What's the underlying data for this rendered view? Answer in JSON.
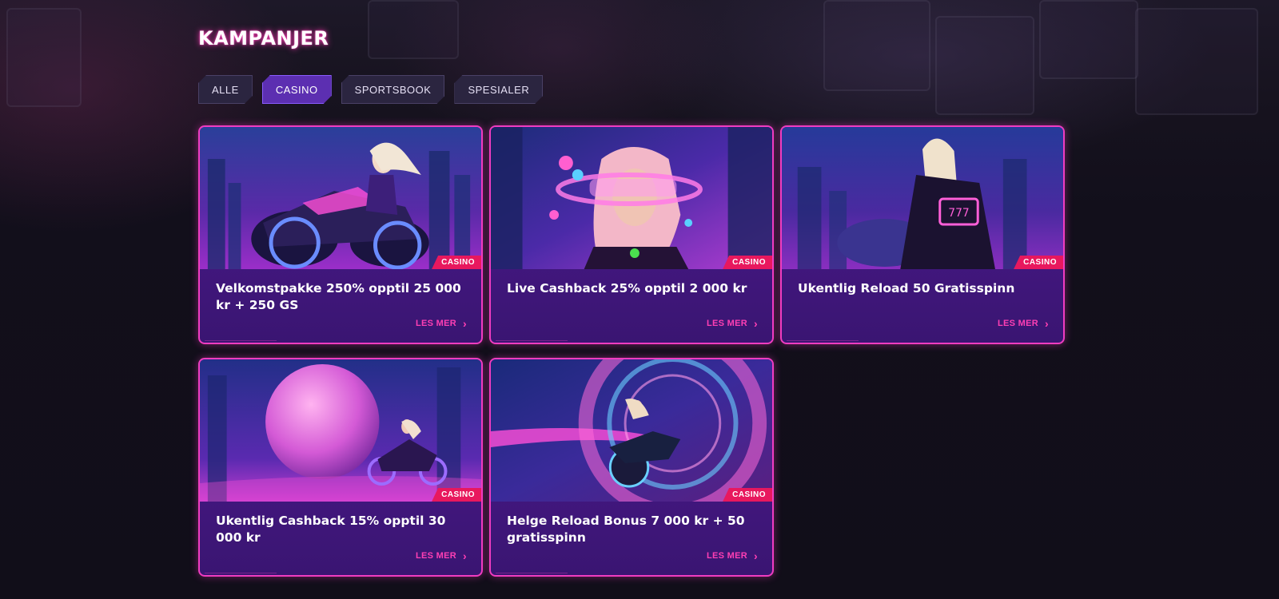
{
  "page": {
    "title": "KAMPANJER",
    "accent_color": "#f03cc0",
    "badge_color": "#e8185e"
  },
  "tabs": [
    {
      "label": "ALLE",
      "active": false
    },
    {
      "label": "CASINO",
      "active": true
    },
    {
      "label": "SPORTSBOOK",
      "active": false
    },
    {
      "label": "SPESIALER",
      "active": false
    }
  ],
  "cards": [
    {
      "title": "Velkomstpakke 250% opptil 25 000 kr + 250 GS",
      "badge": "CASINO",
      "more_label": "LES MER",
      "image": "motorcycle-rider-city"
    },
    {
      "title": "Live Cashback 25% opptil 2 000 kr",
      "badge": "CASINO",
      "more_label": "LES MER",
      "image": "woman-visor-slots"
    },
    {
      "title": "Ukentlig Reload 50 Gratisspinn",
      "badge": "CASINO",
      "more_label": "LES MER",
      "image": "woman-leather-jacket"
    },
    {
      "title": "Ukentlig Cashback 15% opptil 30 000 kr",
      "badge": "CASINO",
      "more_label": "LES MER",
      "image": "pink-sphere-motorcycle"
    },
    {
      "title": "Helge Reload Bonus 7 000 kr + 50 gratisspinn",
      "badge": "CASINO",
      "more_label": "LES MER",
      "image": "motorcycle-neon-tunnel"
    }
  ]
}
